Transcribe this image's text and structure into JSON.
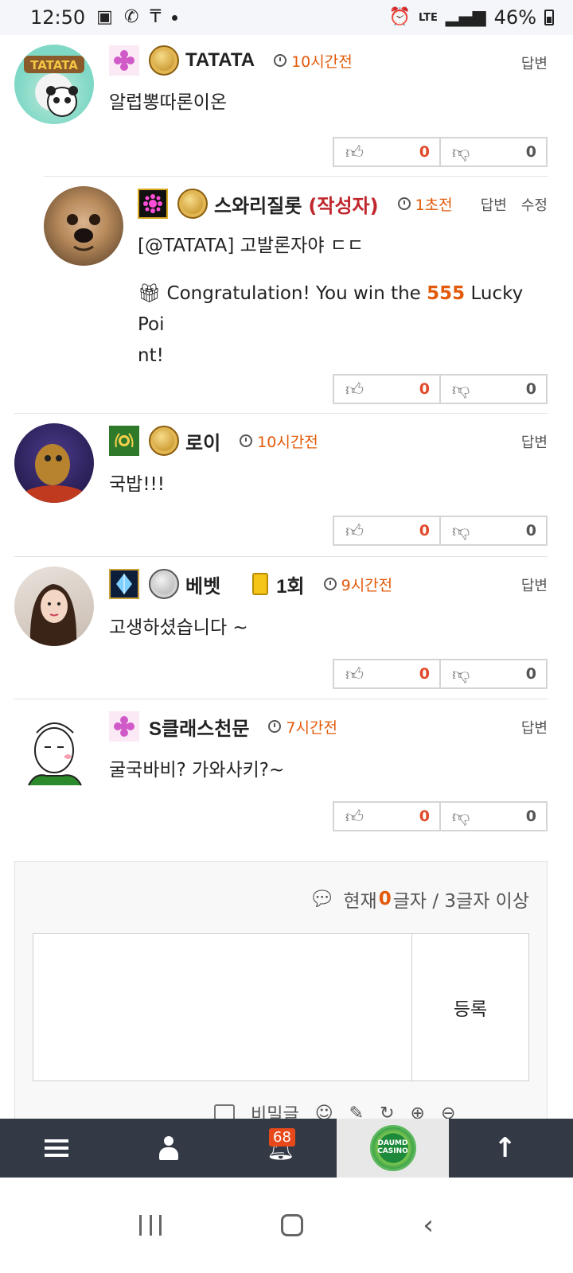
{
  "status_bar": {
    "time": "12:50",
    "network": "LTE",
    "battery": "46%"
  },
  "comments": [
    {
      "nick": "TATATA",
      "time": "10시간전",
      "actions": [
        "답변"
      ],
      "text": "알럽뽕따론이온",
      "up": "0",
      "down": "0"
    },
    {
      "nick": "스와리질롯",
      "author_tag": "(작성자)",
      "time": "1초전",
      "actions": [
        "답변",
        "수정"
      ],
      "text": "[@TATATA] 고발론자야 ㄷㄷ",
      "lucky": {
        "prefix": "Congratulation! You win the ",
        "points": "555",
        "suffix": " Lucky Poi",
        "suffix2": "nt!"
      },
      "up": "0",
      "down": "0"
    },
    {
      "nick": "로이",
      "time": "10시간전",
      "actions": [
        "답변"
      ],
      "text": "국밥!!!",
      "up": "0",
      "down": "0"
    },
    {
      "nick": "베벳",
      "warn": "1회",
      "time": "9시간전",
      "actions": [
        "답변"
      ],
      "text": "고생하셨습니다 ~",
      "up": "0",
      "down": "0"
    },
    {
      "nick": "S클래스천문",
      "time": "7시간전",
      "actions": [
        "답변"
      ],
      "text": "굴국바비? 가와사키?~",
      "up": "0",
      "down": "0"
    }
  ],
  "reply_form": {
    "counter_prefix": "현재 ",
    "count": "0",
    "counter_suffix": "글자 / 3글자 이상",
    "submit_label": "등록",
    "secret_label": "비밀글"
  },
  "bottom_nav": {
    "notification_count": "68",
    "logo_text": "DAUMD CASINO"
  },
  "colors": {
    "accent": "#e25a0a",
    "author": "#c0272d",
    "nav_bg": "#333a45"
  }
}
